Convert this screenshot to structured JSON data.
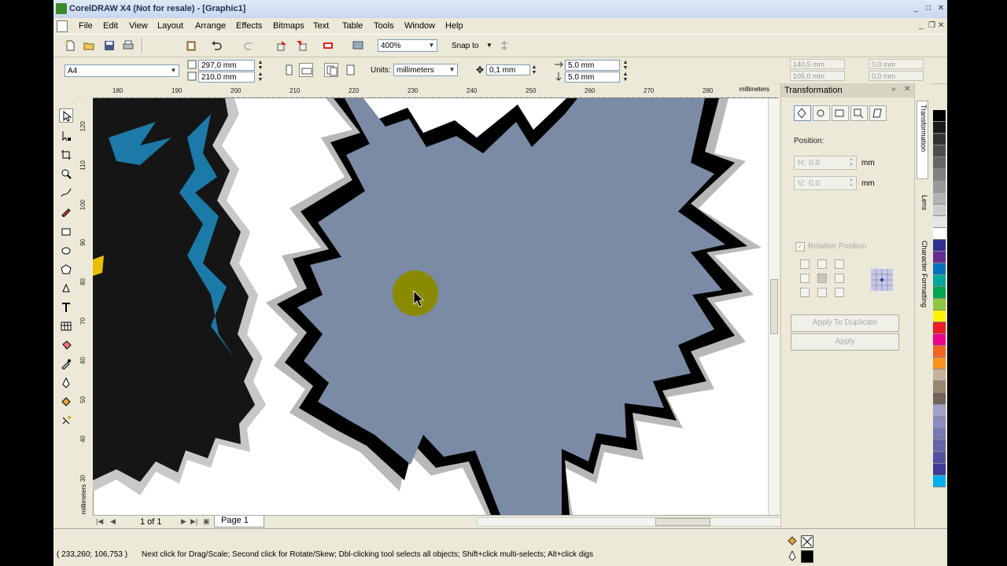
{
  "window": {
    "title": "CorelDRAW X4 (Not for resale) - [Graphic1]"
  },
  "menu": [
    "File",
    "Edit",
    "View",
    "Layout",
    "Arrange",
    "Effects",
    "Bitmaps",
    "Text",
    "Table",
    "Tools",
    "Window",
    "Help"
  ],
  "toolbar": {
    "zoom": "400%",
    "snap_to": "Snap to"
  },
  "property_bar": {
    "paper": "A4",
    "width": "297,0 mm",
    "height": "210,0 mm",
    "units_label": "Units:",
    "units": "millimeters",
    "nudge": "0,1 mm",
    "dup_x": "5,0 mm",
    "dup_y": "5,0 mm",
    "pos_x": "140,5 mm",
    "pos_y": "105,0 mm",
    "size_x": "0,0 mm",
    "size_y": "0,0 mm"
  },
  "rulers": {
    "h_ticks": [
      "180",
      "190",
      "200",
      "210",
      "220",
      "230",
      "240",
      "250",
      "260",
      "270",
      "280"
    ],
    "h_units": "millimeters",
    "v_ticks": [
      "120",
      "110",
      "100",
      "90",
      "80",
      "70",
      "60",
      "50",
      "40",
      "30",
      "20"
    ],
    "v_units": "millimeters"
  },
  "page_nav": {
    "count": "1 of 1",
    "tab": "Page 1"
  },
  "docker": {
    "title": "Transformation",
    "position_label": "Position:",
    "h_prefix": "H:",
    "v_prefix": "V:",
    "h_value": "0,0",
    "v_value": "0,0",
    "unit": "mm",
    "relative_label": "Relative Position",
    "apply_dup": "Apply To Duplicate",
    "apply": "Apply"
  },
  "side_tabs": [
    "Transformation",
    "Lens",
    "Character Formatting"
  ],
  "palette": [
    "#000000",
    "#1a1a1a",
    "#333333",
    "#4d4d4d",
    "#666666",
    "#808080",
    "#999999",
    "#b3b3b3",
    "#cccccc",
    "#e6e6e6",
    "#ffffff",
    "#2e3192",
    "#662d91",
    "#0072bc",
    "#00a99d",
    "#00a651",
    "#8dc63f",
    "#fff200",
    "#ed1c24",
    "#ec008c",
    "#f26522",
    "#f7941d",
    "#c7b299",
    "#998675",
    "#736357",
    "#a0a0c8",
    "#8c8cbe",
    "#7878b4",
    "#6464aa",
    "#5050a0",
    "#3c3c96",
    "#00aeef"
  ],
  "status": {
    "coords": "( 233,260; 106,753 )",
    "hint": "Next click for Drag/Scale; Second click for Rotate/Skew; Dbl-clicking tool selects all objects; Shift+click multi-selects; Alt+click digs"
  },
  "colors": {
    "fill": "#7b8aa5",
    "outline": "#000000",
    "halo": "#b8b8b8",
    "teal": "#1b7aa8",
    "cursor_dot": "#8a8a00"
  }
}
